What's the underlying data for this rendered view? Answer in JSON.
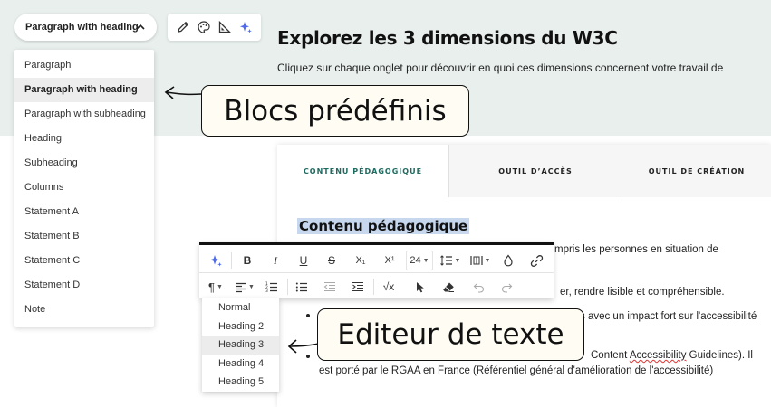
{
  "block_selector": {
    "label": "Paragraph with heading"
  },
  "tools": {
    "icons": [
      "pencil-icon",
      "palette-icon",
      "ruler-triangle-icon",
      "sparkles-icon"
    ],
    "accent": "#4f6bed"
  },
  "block_menu": {
    "items": [
      "Paragraph",
      "Paragraph with heading",
      "Paragraph with subheading",
      "Heading",
      "Subheading",
      "Columns",
      "Statement A",
      "Statement B",
      "Statement C",
      "Statement D",
      "Note"
    ],
    "selected": "Paragraph with heading"
  },
  "page": {
    "title": "Explorez les 3 dimensions du W3C",
    "subtitle": "Cliquez sur chaque onglet pour découvrir en quoi ces dimensions concernent votre travail de",
    "hero_color": "#e8efed"
  },
  "tabs": [
    {
      "label": "CONTENU PÉDAGOGIQUE",
      "active": true
    },
    {
      "label": "OUTIL D’ACCÈS",
      "active": false
    },
    {
      "label": "OUTIL DE CRÉATION",
      "active": false
    }
  ],
  "content": {
    "heading": "Contenu pédagogique",
    "line1_end": "mpris les personnes en situation de",
    "line2_end": "er, rendre lisible et compréhensible.",
    "line3_end": "s avec un impact fort sur l'accessibilité",
    "line4_end_a": "Content ",
    "line4_end_b": "Accessibility",
    "line4_end_c": " Guidelines). Il",
    "line5": "est porté par le RGAA en France (Référentiel général d'amélioration de l'accessibilité)",
    "tab_accent": "#1e6b60",
    "highlight": "#c7d8ee"
  },
  "toolbar": {
    "font_size": "24",
    "row1_icons": [
      "ai-sparkle-icon",
      "bold-icon",
      "italic-icon",
      "underline-icon",
      "strikethrough-icon",
      "subscript-icon",
      "superscript-icon",
      "font-size-select",
      "line-height-icon",
      "columns-icon",
      "fill-color-icon",
      "link-icon"
    ],
    "row2_icons": [
      "paragraph-style-icon",
      "align-icon",
      "numbered-list-icon",
      "bullet-list-icon",
      "outdent-icon",
      "indent-icon",
      "formula-icon",
      "cursor-icon",
      "eraser-icon",
      "undo-icon",
      "redo-icon"
    ],
    "bold": "B",
    "italic": "I",
    "underline": "U",
    "strike": "S",
    "subscript": "X₁",
    "superscript": "X¹"
  },
  "heading_menu": {
    "items": [
      "Normal",
      "Heading 2",
      "Heading 3",
      "Heading 4",
      "Heading 5"
    ],
    "selected": "Heading 3"
  },
  "callouts": {
    "blocks": "Blocs prédéfinis",
    "editor": "Editeur de texte"
  }
}
